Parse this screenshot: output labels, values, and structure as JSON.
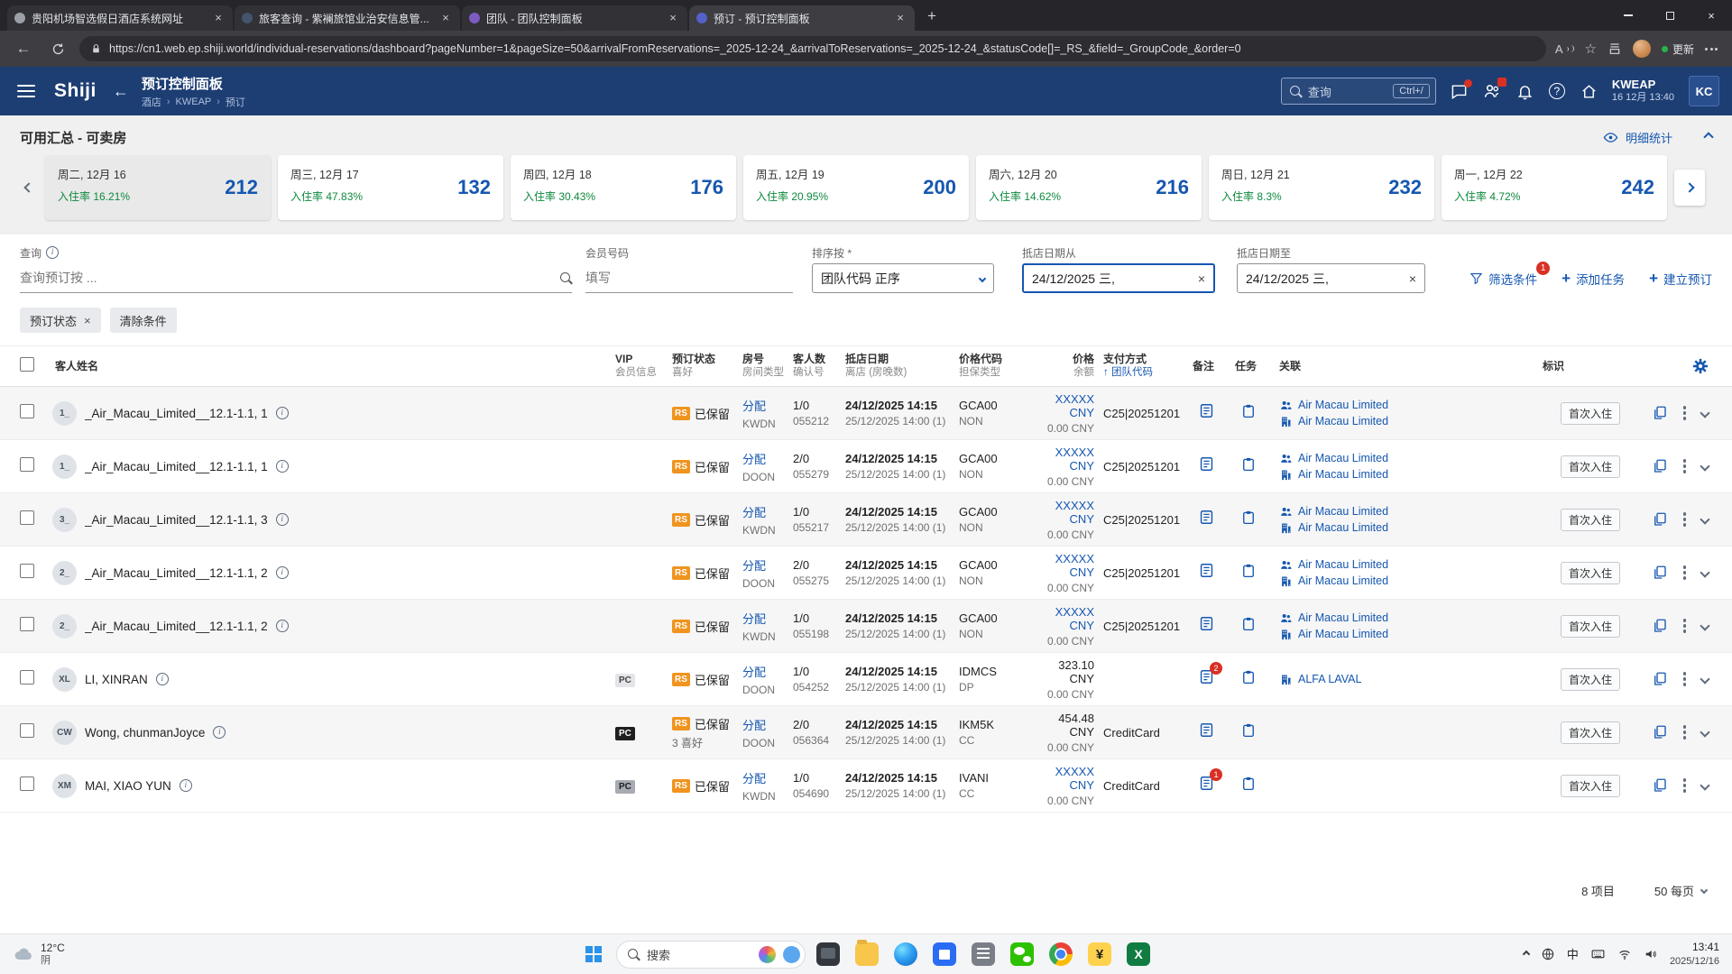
{
  "browser": {
    "tabs": [
      {
        "title": "贵阳机场智选假日酒店系统网址"
      },
      {
        "title": "旅客查询 - 紫襕旅馆业治安信息管..."
      },
      {
        "title": "团队 - 团队控制面板"
      },
      {
        "title": "预订 - 预订控制面板"
      }
    ],
    "url": "https://cn1.web.ep.shiji.world/individual-reservations/dashboard?pageNumber=1&pageSize=50&arrivalFromReservations=_2025-12-24_&arrivalToReservations=_2025-12-24_&statusCode[]=_RS_&field=_GroupCode_&order=0",
    "update_label": "更新"
  },
  "app_header": {
    "logo": "Shiji",
    "title": "预订控制面板",
    "breadcrumb": [
      "酒店",
      "KWEAP",
      "预订"
    ],
    "search_placeholder": "查询",
    "search_shortcut": "Ctrl+/",
    "property_code": "KWEAP",
    "datetime": "16 12月 13:40",
    "user_initials": "KC"
  },
  "summary": {
    "title": "可用汇总 - 可卖房",
    "detail_link": "明细统计",
    "cards": [
      {
        "date": "周二, 12月 16",
        "occ": "入住率 16.21%",
        "value": "212"
      },
      {
        "date": "周三, 12月 17",
        "occ": "入住率 47.83%",
        "value": "132"
      },
      {
        "date": "周四, 12月 18",
        "occ": "入住率 30.43%",
        "value": "176"
      },
      {
        "date": "周五, 12月 19",
        "occ": "入住率 20.95%",
        "value": "200"
      },
      {
        "date": "周六, 12月 20",
        "occ": "入住率 14.62%",
        "value": "216"
      },
      {
        "date": "周日, 12月 21",
        "occ": "入住率 8.3%",
        "value": "232"
      },
      {
        "date": "周一, 12月 22",
        "occ": "入住率 4.72%",
        "value": "242"
      }
    ]
  },
  "filters": {
    "query_label": "查询",
    "query_placeholder": "查询预订按 ...",
    "member_label": "会员号码",
    "member_placeholder": "填写",
    "sort_label": "排序按 *",
    "sort_value": "团队代码 正序",
    "date_from_label": "抵店日期从",
    "date_from_value": "24/12/2025 三,",
    "date_to_label": "抵店日期至",
    "date_to_value": "24/12/2025 三,",
    "filter_button": "筛选条件",
    "filter_badge": "1",
    "add_task_label": "添加任务",
    "create_booking_label": "建立预订",
    "chip_status": "预订状态",
    "chip_clear": "清除条件"
  },
  "table": {
    "columns": {
      "guest": "客人姓名",
      "vip_line1": "VIP",
      "vip_line2": "会员信息",
      "status_line1": "预订状态",
      "status_line2": "喜好",
      "room_line1": "房号",
      "room_line2": "房间类型",
      "guests_line1": "客人数",
      "guests_line2": "确认号",
      "date_line1": "抵店日期",
      "date_line2": "离店 (房晚数)",
      "rate_line1": "价格代码",
      "rate_line2": "担保类型",
      "price_line1": "价格",
      "price_line2": "余额",
      "pay_line1": "支付方式",
      "pay_line2": "↑ 团队代码",
      "notes": "备注",
      "tasks": "任务",
      "links": "关联",
      "tags": "标识"
    },
    "rows": [
      {
        "initials": "1_",
        "name": "_Air_Macau_Limited__12.1-1.1, 1",
        "vip": "",
        "vip_variant": "",
        "status_code": "RS",
        "status_text": "已保留",
        "status_extra": "",
        "room_action": "分配",
        "room_type": "KWDN",
        "guests": "1/0",
        "conf": "055212",
        "arrival": "24/12/2025 14:15",
        "departure": "25/12/2025 14:00 (1)",
        "rate_code": "GCA00",
        "guarantee": "NON",
        "price": "XXXXX CNY",
        "price_variant": "masked",
        "balance": "0.00 CNY",
        "payment": "C25|20251201",
        "note_badge": "",
        "link1_icon": "agent",
        "link1_label": "Air Macau Limited",
        "link2_icon": "company",
        "link2_label": "Air Macau Limited",
        "tag": "首次入住"
      },
      {
        "initials": "1_",
        "name": "_Air_Macau_Limited__12.1-1.1, 1",
        "vip": "",
        "vip_variant": "",
        "status_code": "RS",
        "status_text": "已保留",
        "status_extra": "",
        "room_action": "分配",
        "room_type": "DOON",
        "guests": "2/0",
        "conf": "055279",
        "arrival": "24/12/2025 14:15",
        "departure": "25/12/2025 14:00 (1)",
        "rate_code": "GCA00",
        "guarantee": "NON",
        "price": "XXXXX CNY",
        "price_variant": "masked",
        "balance": "0.00 CNY",
        "payment": "C25|20251201",
        "note_badge": "",
        "link1_icon": "agent",
        "link1_label": "Air Macau Limited",
        "link2_icon": "company",
        "link2_label": "Air Macau Limited",
        "tag": "首次入住"
      },
      {
        "initials": "3_",
        "name": "_Air_Macau_Limited__12.1-1.1, 3",
        "vip": "",
        "vip_variant": "",
        "status_code": "RS",
        "status_text": "已保留",
        "status_extra": "",
        "room_action": "分配",
        "room_type": "KWDN",
        "guests": "1/0",
        "conf": "055217",
        "arrival": "24/12/2025 14:15",
        "departure": "25/12/2025 14:00 (1)",
        "rate_code": "GCA00",
        "guarantee": "NON",
        "price": "XXXXX CNY",
        "price_variant": "masked",
        "balance": "0.00 CNY",
        "payment": "C25|20251201",
        "note_badge": "",
        "link1_icon": "agent",
        "link1_label": "Air Macau Limited",
        "link2_icon": "company",
        "link2_label": "Air Macau Limited",
        "tag": "首次入住"
      },
      {
        "initials": "2_",
        "name": "_Air_Macau_Limited__12.1-1.1, 2",
        "vip": "",
        "vip_variant": "",
        "status_code": "RS",
        "status_text": "已保留",
        "status_extra": "",
        "room_action": "分配",
        "room_type": "DOON",
        "guests": "2/0",
        "conf": "055275",
        "arrival": "24/12/2025 14:15",
        "departure": "25/12/2025 14:00 (1)",
        "rate_code": "GCA00",
        "guarantee": "NON",
        "price": "XXXXX CNY",
        "price_variant": "masked",
        "balance": "0.00 CNY",
        "payment": "C25|20251201",
        "note_badge": "",
        "link1_icon": "agent",
        "link1_label": "Air Macau Limited",
        "link2_icon": "company",
        "link2_label": "Air Macau Limited",
        "tag": "首次入住"
      },
      {
        "initials": "2_",
        "name": "_Air_Macau_Limited__12.1-1.1, 2",
        "vip": "",
        "vip_variant": "",
        "status_code": "RS",
        "status_text": "已保留",
        "status_extra": "",
        "room_action": "分配",
        "room_type": "KWDN",
        "guests": "1/0",
        "conf": "055198",
        "arrival": "24/12/2025 14:15",
        "departure": "25/12/2025 14:00 (1)",
        "rate_code": "GCA00",
        "guarantee": "NON",
        "price": "XXXXX CNY",
        "price_variant": "masked",
        "balance": "0.00 CNY",
        "payment": "C25|20251201",
        "note_badge": "",
        "link1_icon": "agent",
        "link1_label": "Air Macau Limited",
        "link2_icon": "company",
        "link2_label": "Air Macau Limited",
        "tag": "首次入住"
      },
      {
        "initials": "XL",
        "name": "LI, XINRAN",
        "vip": "PC",
        "vip_variant": "light",
        "status_code": "RS",
        "status_text": "已保留",
        "status_extra": "",
        "room_action": "分配",
        "room_type": "DOON",
        "guests": "1/0",
        "conf": "054252",
        "arrival": "24/12/2025 14:15",
        "departure": "25/12/2025 14:00 (1)",
        "rate_code": "IDMCS",
        "guarantee": "DP",
        "price": "323.10 CNY",
        "price_variant": "normal",
        "balance": "0.00 CNY",
        "payment": "",
        "note_badge": "2",
        "link1_icon": "company",
        "link1_label": "ALFA LAVAL",
        "link2_icon": "",
        "link2_label": "",
        "tag": "首次入住"
      },
      {
        "initials": "CW",
        "name": "Wong, chunmanJoyce",
        "vip": "PC",
        "vip_variant": "dark",
        "status_code": "RS",
        "status_text": "已保留",
        "status_extra": "3 喜好",
        "room_action": "分配",
        "room_type": "DOON",
        "guests": "2/0",
        "conf": "056364",
        "arrival": "24/12/2025 14:15",
        "departure": "25/12/2025 14:00 (1)",
        "rate_code": "IKM5K",
        "guarantee": "CC",
        "price": "454.48 CNY",
        "price_variant": "normal",
        "balance": "0.00 CNY",
        "payment": "CreditCard",
        "note_badge": "",
        "link1_icon": "",
        "link1_label": "",
        "link2_icon": "",
        "link2_label": "",
        "tag": "首次入住"
      },
      {
        "initials": "XM",
        "name": "MAI, XIAO YUN",
        "vip": "PC",
        "vip_variant": "gray",
        "status_code": "RS",
        "status_text": "已保留",
        "status_extra": "",
        "room_action": "分配",
        "room_type": "KWDN",
        "guests": "1/0",
        "conf": "054690",
        "arrival": "24/12/2025 14:15",
        "departure": "25/12/2025 14:00 (1)",
        "rate_code": "IVANI",
        "guarantee": "CC",
        "price": "XXXXX CNY",
        "price_variant": "masked",
        "balance": "0.00 CNY",
        "payment": "CreditCard",
        "note_badge": "1",
        "link1_icon": "",
        "link1_label": "",
        "link2_icon": "",
        "link2_label": "",
        "tag": "首次入住"
      }
    ],
    "footer": {
      "count": "8 项目",
      "page_size": "50 每页"
    }
  },
  "taskbar": {
    "weather_temp": "12°C",
    "weather_desc": "阴",
    "search_placeholder": "搜索",
    "ime_label": "中",
    "clock_time": "13:41",
    "clock_date": "2025/12/16"
  }
}
